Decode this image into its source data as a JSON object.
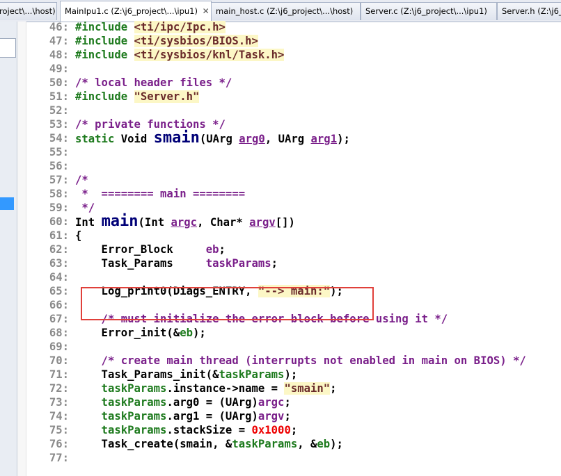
{
  "tabs": [
    {
      "label": "roject\\...\\host)",
      "active": false
    },
    {
      "label": "MainIpu1.c (Z:\\j6_project\\...\\ipu1)",
      "active": true
    },
    {
      "label": "main_host.c (Z:\\j6_project\\...\\host)",
      "active": false
    },
    {
      "label": "Server.c (Z:\\j6_project\\...\\ipu1)",
      "active": false
    },
    {
      "label": "Server.h (Z:\\j6_projec",
      "active": false
    }
  ],
  "tab_close_glyph": "✕",
  "colors": {
    "keyword": "#1d7a1d",
    "comment": "#7a1f8a",
    "string": "#6a2a2a",
    "string_bg": "#fcf7c6",
    "number": "#ee0000",
    "highlight_box": "#e0403a",
    "selection": "#3399ff"
  },
  "code_lines": [
    {
      "n": "46:",
      "segs": [
        {
          "t": "#include ",
          "c": "kw"
        },
        {
          "t": "<ti/ipc/Ipc.h>",
          "c": "str"
        }
      ]
    },
    {
      "n": "47:",
      "segs": [
        {
          "t": "#include ",
          "c": "kw"
        },
        {
          "t": "<ti/sysbios/BIOS.h>",
          "c": "str"
        }
      ]
    },
    {
      "n": "48:",
      "segs": [
        {
          "t": "#include ",
          "c": "kw"
        },
        {
          "t": "<ti/sysbios/knl/Task.h>",
          "c": "str"
        }
      ]
    },
    {
      "n": "49:",
      "segs": []
    },
    {
      "n": "50:",
      "segs": [
        {
          "t": "/* local header files */",
          "c": "cm"
        }
      ]
    },
    {
      "n": "51:",
      "segs": [
        {
          "t": "#include ",
          "c": "kw"
        },
        {
          "t": "\"Server.h\"",
          "c": "str"
        }
      ]
    },
    {
      "n": "52:",
      "segs": []
    },
    {
      "n": "53:",
      "segs": [
        {
          "t": "/* private functions */",
          "c": "cm"
        }
      ]
    },
    {
      "n": "54:",
      "segs": [
        {
          "t": "static ",
          "c": "kw"
        },
        {
          "t": "Void ",
          "c": ""
        },
        {
          "t": "smain",
          "c": "fn-big"
        },
        {
          "t": "(UArg ",
          "c": ""
        },
        {
          "t": "arg0",
          "c": "param"
        },
        {
          "t": ", UArg ",
          "c": ""
        },
        {
          "t": "arg1",
          "c": "param"
        },
        {
          "t": ");",
          "c": ""
        }
      ]
    },
    {
      "n": "55:",
      "segs": []
    },
    {
      "n": "56:",
      "segs": []
    },
    {
      "n": "57:",
      "segs": [
        {
          "t": "/*",
          "c": "cm"
        }
      ]
    },
    {
      "n": "58:",
      "segs": [
        {
          "t": " *  ======== main ========",
          "c": "cm"
        }
      ]
    },
    {
      "n": "59:",
      "segs": [
        {
          "t": " */",
          "c": "cm"
        }
      ]
    },
    {
      "n": "60:",
      "segs": [
        {
          "t": "Int ",
          "c": ""
        },
        {
          "t": "main",
          "c": "fn-big"
        },
        {
          "t": "(Int ",
          "c": ""
        },
        {
          "t": "argc",
          "c": "param"
        },
        {
          "t": ", Char* ",
          "c": ""
        },
        {
          "t": "argv",
          "c": "param"
        },
        {
          "t": "[])",
          "c": ""
        }
      ]
    },
    {
      "n": "61:",
      "segs": [
        {
          "t": "{",
          "c": ""
        }
      ]
    },
    {
      "n": "62:",
      "segs": [
        {
          "t": "    Error_Block     ",
          "c": ""
        },
        {
          "t": "eb",
          "c": "pv"
        },
        {
          "t": ";",
          "c": ""
        }
      ]
    },
    {
      "n": "63:",
      "segs": [
        {
          "t": "    Task_Params     ",
          "c": ""
        },
        {
          "t": "taskParams",
          "c": "pv"
        },
        {
          "t": ";",
          "c": ""
        }
      ]
    },
    {
      "n": "64:",
      "segs": []
    },
    {
      "n": "65:",
      "segs": [
        {
          "t": "    Log_print0(Diags_ENTRY, ",
          "c": ""
        },
        {
          "t": "\"--> main:\"",
          "c": "str"
        },
        {
          "t": ");",
          "c": ""
        }
      ]
    },
    {
      "n": "66:",
      "segs": []
    },
    {
      "n": "67:",
      "segs": [
        {
          "t": "    /* must initialize the error block before using it */",
          "c": "cm"
        }
      ]
    },
    {
      "n": "68:",
      "segs": [
        {
          "t": "    Error_init(&",
          "c": ""
        },
        {
          "t": "eb",
          "c": "kw"
        },
        {
          "t": ");",
          "c": ""
        }
      ]
    },
    {
      "n": "69:",
      "segs": []
    },
    {
      "n": "70:",
      "segs": [
        {
          "t": "    /* create main thread (interrupts not enabled in main on BIOS) */",
          "c": "cm"
        }
      ]
    },
    {
      "n": "71:",
      "segs": [
        {
          "t": "    Task_Params_init(&",
          "c": ""
        },
        {
          "t": "taskParams",
          "c": "kw"
        },
        {
          "t": ");",
          "c": ""
        }
      ]
    },
    {
      "n": "72:",
      "segs": [
        {
          "t": "    taskParams",
          "c": "kw"
        },
        {
          "t": ".instance->name = ",
          "c": ""
        },
        {
          "t": "\"smain\"",
          "c": "str"
        },
        {
          "t": ";",
          "c": ""
        }
      ]
    },
    {
      "n": "73:",
      "segs": [
        {
          "t": "    taskParams",
          "c": "kw"
        },
        {
          "t": ".arg0 = (UArg)",
          "c": ""
        },
        {
          "t": "argc",
          "c": "pv"
        },
        {
          "t": ";",
          "c": ""
        }
      ]
    },
    {
      "n": "74:",
      "segs": [
        {
          "t": "    taskParams",
          "c": "kw"
        },
        {
          "t": ".arg1 = (UArg)",
          "c": ""
        },
        {
          "t": "argv",
          "c": "pv"
        },
        {
          "t": ";",
          "c": ""
        }
      ]
    },
    {
      "n": "75:",
      "segs": [
        {
          "t": "    taskParams",
          "c": "kw"
        },
        {
          "t": ".stackSize = ",
          "c": ""
        },
        {
          "t": "0x1000",
          "c": "num"
        },
        {
          "t": ";",
          "c": ""
        }
      ]
    },
    {
      "n": "76:",
      "segs": [
        {
          "t": "    Task_create(smain, &",
          "c": ""
        },
        {
          "t": "taskParams",
          "c": "kw"
        },
        {
          "t": ", &",
          "c": ""
        },
        {
          "t": "eb",
          "c": "kw"
        },
        {
          "t": ");",
          "c": ""
        }
      ]
    },
    {
      "n": "77:",
      "segs": []
    }
  ]
}
